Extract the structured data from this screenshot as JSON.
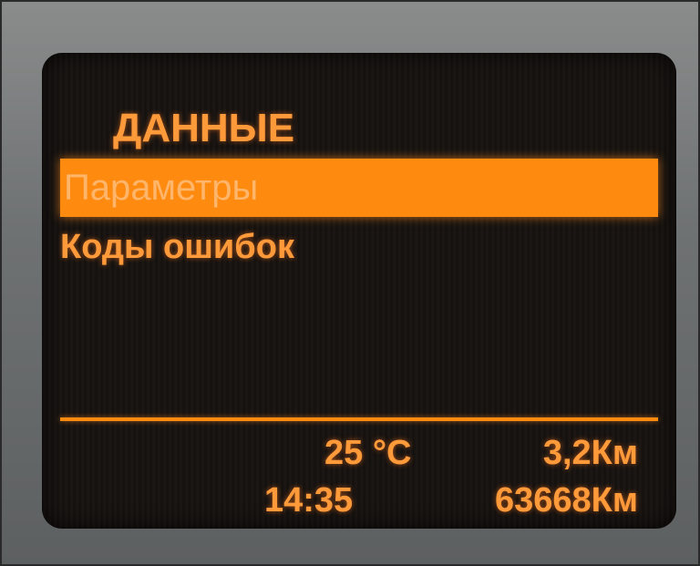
{
  "menu": {
    "title": "ДАННЫЕ",
    "items": [
      {
        "label": "Параметры",
        "selected": true
      },
      {
        "label": "Коды ошибок",
        "selected": false
      }
    ]
  },
  "status": {
    "temperature": "25 °C",
    "trip_distance": "3,2Км",
    "time": "14:35",
    "odometer": "63668Км"
  },
  "colors": {
    "accent": "#ff8a10",
    "text": "#ff9a3a",
    "screen_bg": "#151210",
    "bezel": "#6f7273"
  }
}
